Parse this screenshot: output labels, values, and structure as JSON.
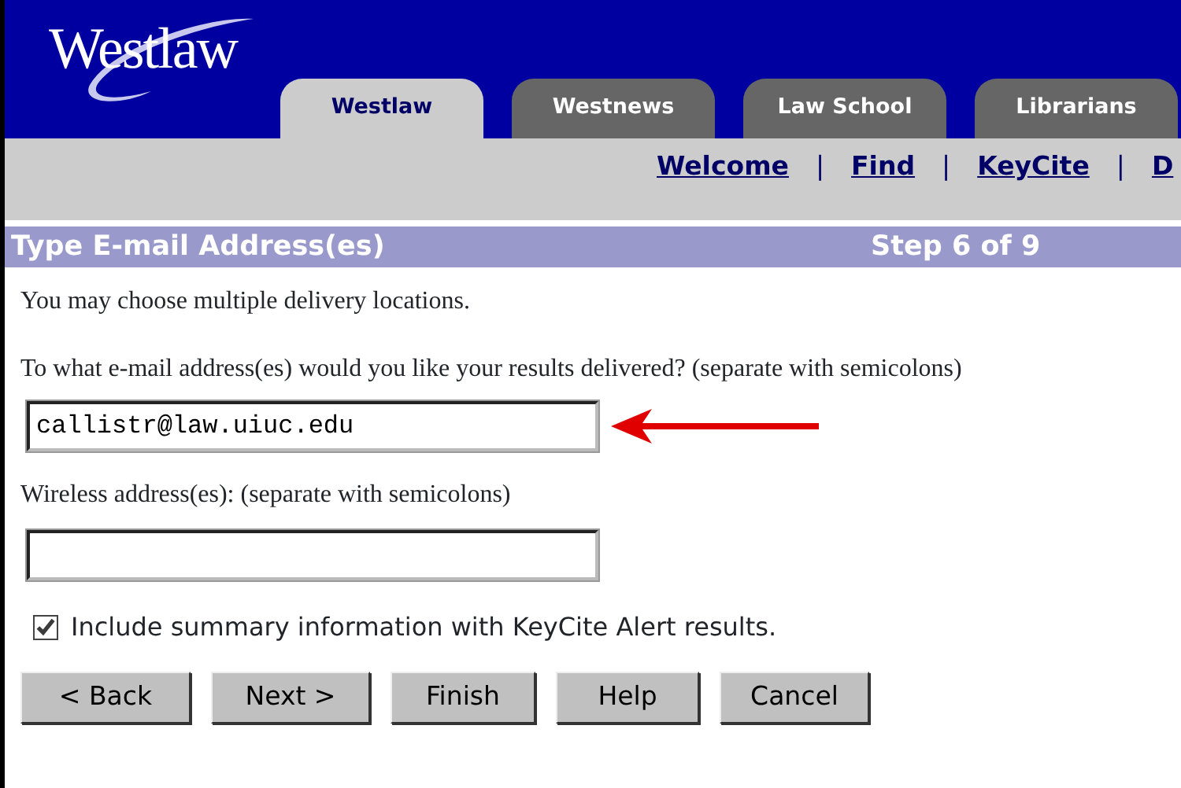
{
  "logo": "Westlaw",
  "tabs": [
    {
      "label": "Westlaw",
      "selected": true
    },
    {
      "label": "Westnews",
      "selected": false
    },
    {
      "label": "Law School",
      "selected": false
    },
    {
      "label": "Librarians",
      "selected": false
    }
  ],
  "nav": [
    {
      "kind": "link",
      "text": "Welcome"
    },
    {
      "kind": "separator",
      "text": "|"
    },
    {
      "kind": "link",
      "text": "Find"
    },
    {
      "kind": "separator",
      "text": "|"
    },
    {
      "kind": "link",
      "text": "KeyCite"
    },
    {
      "kind": "separator",
      "text": "|"
    },
    {
      "kind": "link",
      "text": "D"
    }
  ],
  "section": {
    "title": "Type E-mail Address(es)",
    "step": "Step 6 of 9"
  },
  "intro": "You may choose multiple delivery locations.",
  "email": {
    "label": "To what e-mail address(es) would you like your results delivered? (separate with semicolons)",
    "value": "callistr@law.uiuc.edu"
  },
  "wireless": {
    "label": "Wireless address(es): (separate with semicolons)"
  },
  "summary_option": {
    "label": "Include summary information with KeyCite Alert results.",
    "checked": true
  },
  "buttons": [
    "< Back",
    "Next >",
    "Finish",
    "Help",
    "Cancel"
  ]
}
